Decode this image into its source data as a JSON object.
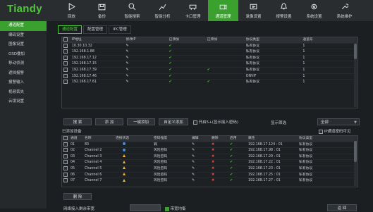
{
  "app": {
    "logo": "Tiandy"
  },
  "colors": {
    "accent": "#3aa12f",
    "check": "#4fc73b",
    "error": "#e0443a",
    "warn": "#f0b72f",
    "online": "#3e8fe6"
  },
  "nav": [
    {
      "label": "回放",
      "icon": "play-icon",
      "active": false
    },
    {
      "label": "备份",
      "icon": "backup-icon",
      "active": false
    },
    {
      "label": "智能搜索",
      "icon": "smart-search-icon",
      "active": false
    },
    {
      "label": "智能分析",
      "icon": "analysis-icon",
      "active": false
    },
    {
      "label": "卡口管理",
      "icon": "checkpoint-icon",
      "active": false
    },
    {
      "label": "通道管理",
      "icon": "camera-icon",
      "active": true
    },
    {
      "label": "录像设置",
      "icon": "record-icon",
      "active": false
    },
    {
      "label": "报警设置",
      "icon": "alarm-icon",
      "active": false
    },
    {
      "label": "系统设置",
      "icon": "settings-icon",
      "active": false
    },
    {
      "label": "系统维护",
      "icon": "maintenance-icon",
      "active": false
    }
  ],
  "sidebar": [
    {
      "label": "通道配置",
      "active": true
    },
    {
      "label": "编码设置",
      "active": false
    },
    {
      "label": "图像设置",
      "active": false
    },
    {
      "label": "OSD叠加",
      "active": false
    },
    {
      "label": "移动侦测",
      "active": false
    },
    {
      "label": "遮挡报警",
      "active": false
    },
    {
      "label": "报警输入",
      "active": false
    },
    {
      "label": "视频丢失",
      "active": false
    },
    {
      "label": "云镜设置",
      "active": false
    }
  ],
  "tabs": [
    {
      "label": "通道配置",
      "active": true
    },
    {
      "label": "配置管理",
      "active": false
    },
    {
      "label": "IPC管理",
      "active": false
    }
  ],
  "search_table": {
    "headers": [
      "IP地址",
      "修改IP",
      "已添加",
      "已添加",
      "协议类型",
      "通道号"
    ],
    "rows": [
      {
        "ip": "10.30.10.32",
        "edit": true,
        "added1": true,
        "added2": false,
        "protocol": "私有协议",
        "channel": "1"
      },
      {
        "ip": "192.168.1.88",
        "edit": true,
        "added1": true,
        "added2": false,
        "protocol": "私有协议",
        "channel": "1"
      },
      {
        "ip": "192.168.17.12",
        "edit": true,
        "added1": true,
        "added2": false,
        "protocol": "私有协议",
        "channel": "1"
      },
      {
        "ip": "192.168.17.15",
        "edit": true,
        "added1": true,
        "added2": false,
        "protocol": "私有协议",
        "channel": "1"
      },
      {
        "ip": "192.168.17.39",
        "edit": true,
        "added1": true,
        "added2": true,
        "protocol": "私有协议",
        "channel": "1"
      },
      {
        "ip": "192.168.17.46",
        "edit": true,
        "added1": true,
        "added2": false,
        "protocol": "ONVIF",
        "channel": "1"
      },
      {
        "ip": "192.168.17.61",
        "edit": true,
        "added1": true,
        "added2": true,
        "protocol": "私有协议",
        "channel": "1"
      }
    ]
  },
  "buttons": {
    "search": "搜 索",
    "add": "添 加",
    "one_click_add": "一键添加",
    "custom_add": "自定义添加",
    "checkbox_label": "开启5+(显示接入密码)",
    "display_filter_label": "显示筛选",
    "filter_value": "全部",
    "delete": "删 除",
    "return": "返 回"
  },
  "added_section": {
    "title": "已添加设备",
    "strong_password_label": "IP通道密码可见",
    "headers": [
      "通道",
      "名称",
      "连接状态",
      "密码强度",
      "编辑",
      "删除",
      "启用",
      "属性",
      "协议类型"
    ],
    "rows": [
      {
        "ch": "01",
        "name": "83",
        "status": "online",
        "strength": "弱",
        "enabled": true,
        "attr": "192.168.17.124 : 01",
        "protocol": "私有协议"
      },
      {
        "ch": "02",
        "name": "Channel 2",
        "status": "online",
        "strength": "风险密码",
        "enabled": true,
        "attr": "192.168.17.98 : 01",
        "protocol": "私有协议"
      },
      {
        "ch": "03",
        "name": "Channel 3",
        "status": "warn",
        "strength": "风险密码",
        "enabled": true,
        "attr": "192.168.17.29 : 01",
        "protocol": "私有协议"
      },
      {
        "ch": "04",
        "name": "Channel 4",
        "status": "warn",
        "strength": "风险密码",
        "enabled": true,
        "attr": "192.168.17.22 : 01",
        "protocol": "私有协议"
      },
      {
        "ch": "05",
        "name": "Channel 5",
        "status": "warn",
        "strength": "风险密码",
        "enabled": true,
        "attr": "192.168.17.23 : 01",
        "protocol": "私有协议"
      },
      {
        "ch": "06",
        "name": "Channel 6",
        "status": "warn",
        "strength": "风险密码",
        "enabled": true,
        "attr": "192.168.17.25 : 01",
        "protocol": "私有协议"
      },
      {
        "ch": "07",
        "name": "Channel 7",
        "status": "warn",
        "strength": "风险密码",
        "enabled": true,
        "attr": "192.168.17.27 : 01",
        "protocol": "私有协议"
      }
    ]
  },
  "bottom": {
    "bandwidth_label": "网络接入剩余带宽",
    "bandwidth_value": "",
    "balance_label": "带宽均衡"
  }
}
